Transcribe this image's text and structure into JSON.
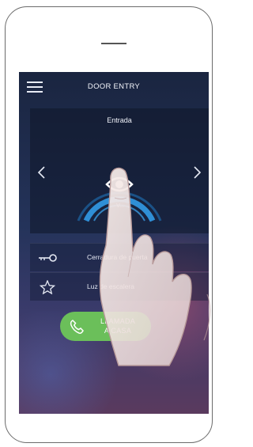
{
  "header": {
    "title": "DOOR ENTRY"
  },
  "camera": {
    "title": "Entrada",
    "eye_label": "V..."
  },
  "actions": [
    {
      "label": "Cerradura de puerta",
      "icon": "key-icon"
    },
    {
      "label": "Luz de escalera",
      "icon": "star-icon"
    }
  ],
  "call_button": {
    "line1": "LLAMADA",
    "line2": "A CASA",
    "icon": "phone-icon",
    "color": "#6bbf5a"
  },
  "colors": {
    "screen_top": "#1a2540",
    "screen_bottom": "#5a3a5e",
    "accent_ring": "#2f8fd6"
  }
}
